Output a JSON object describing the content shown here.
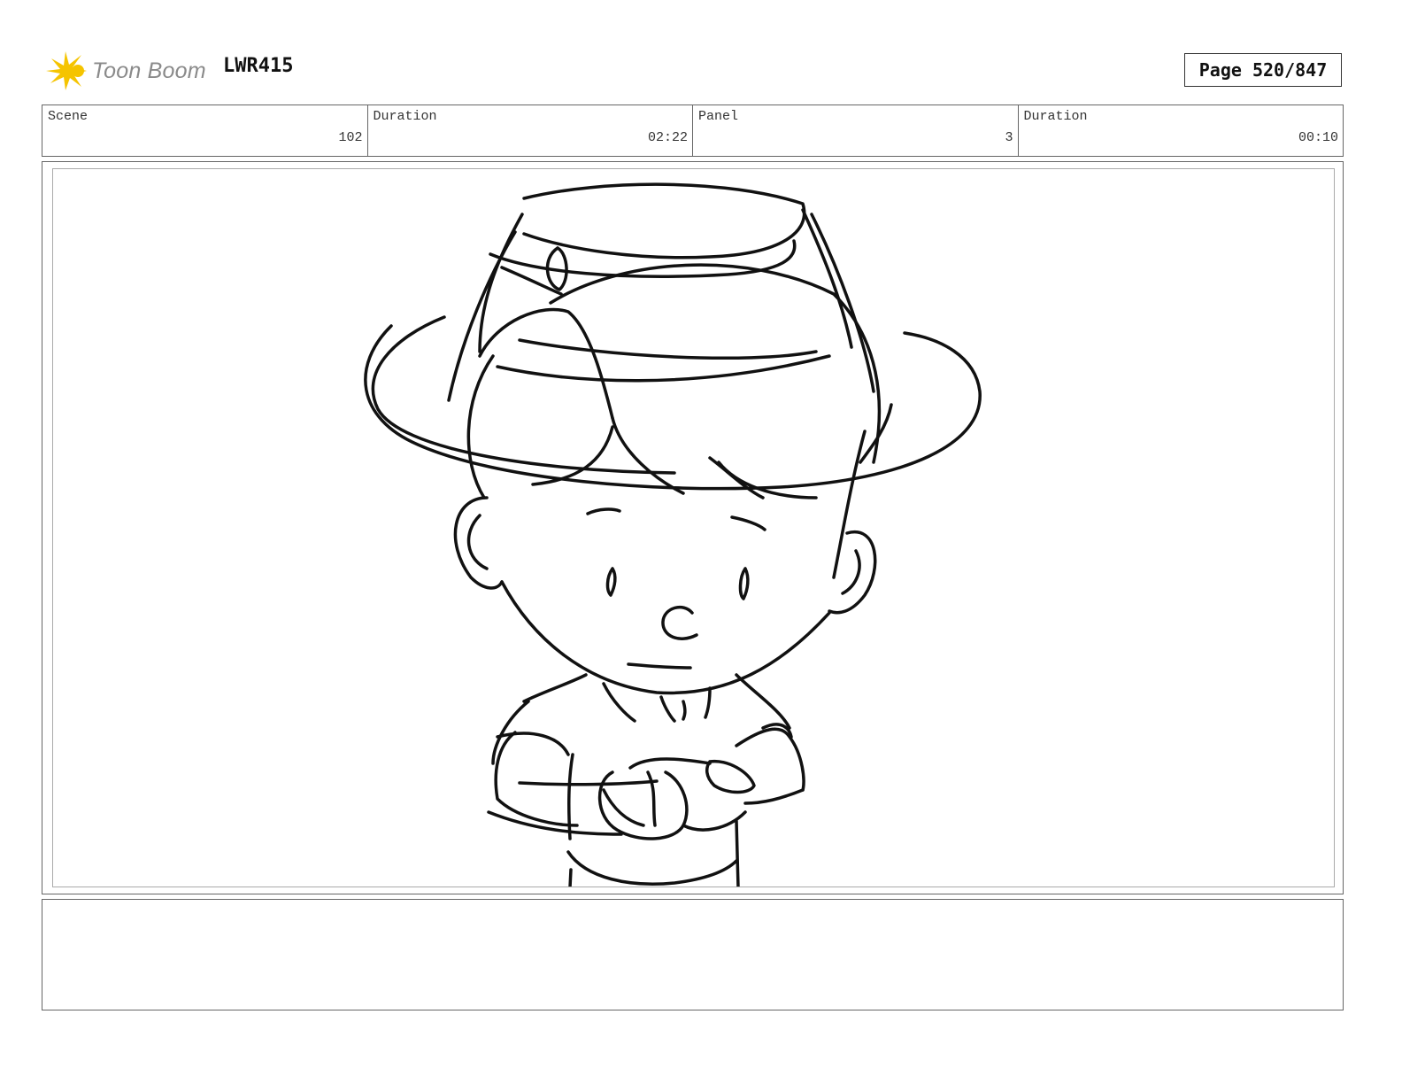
{
  "header": {
    "logo_text": "Toon Boom",
    "episode": "LWR415",
    "page": "Page 520/847"
  },
  "info": {
    "scene_label": "Scene",
    "scene_value": "102",
    "scene_duration_label": "Duration",
    "scene_duration_value": "02:22",
    "panel_label": "Panel",
    "panel_value": "3",
    "panel_duration_label": "Duration",
    "panel_duration_value": "00:10"
  },
  "notes": {
    "text": ""
  },
  "colors": {
    "logo_accent": "#f5c400",
    "logo_text": "#8a8a8a",
    "border": "#666666"
  }
}
